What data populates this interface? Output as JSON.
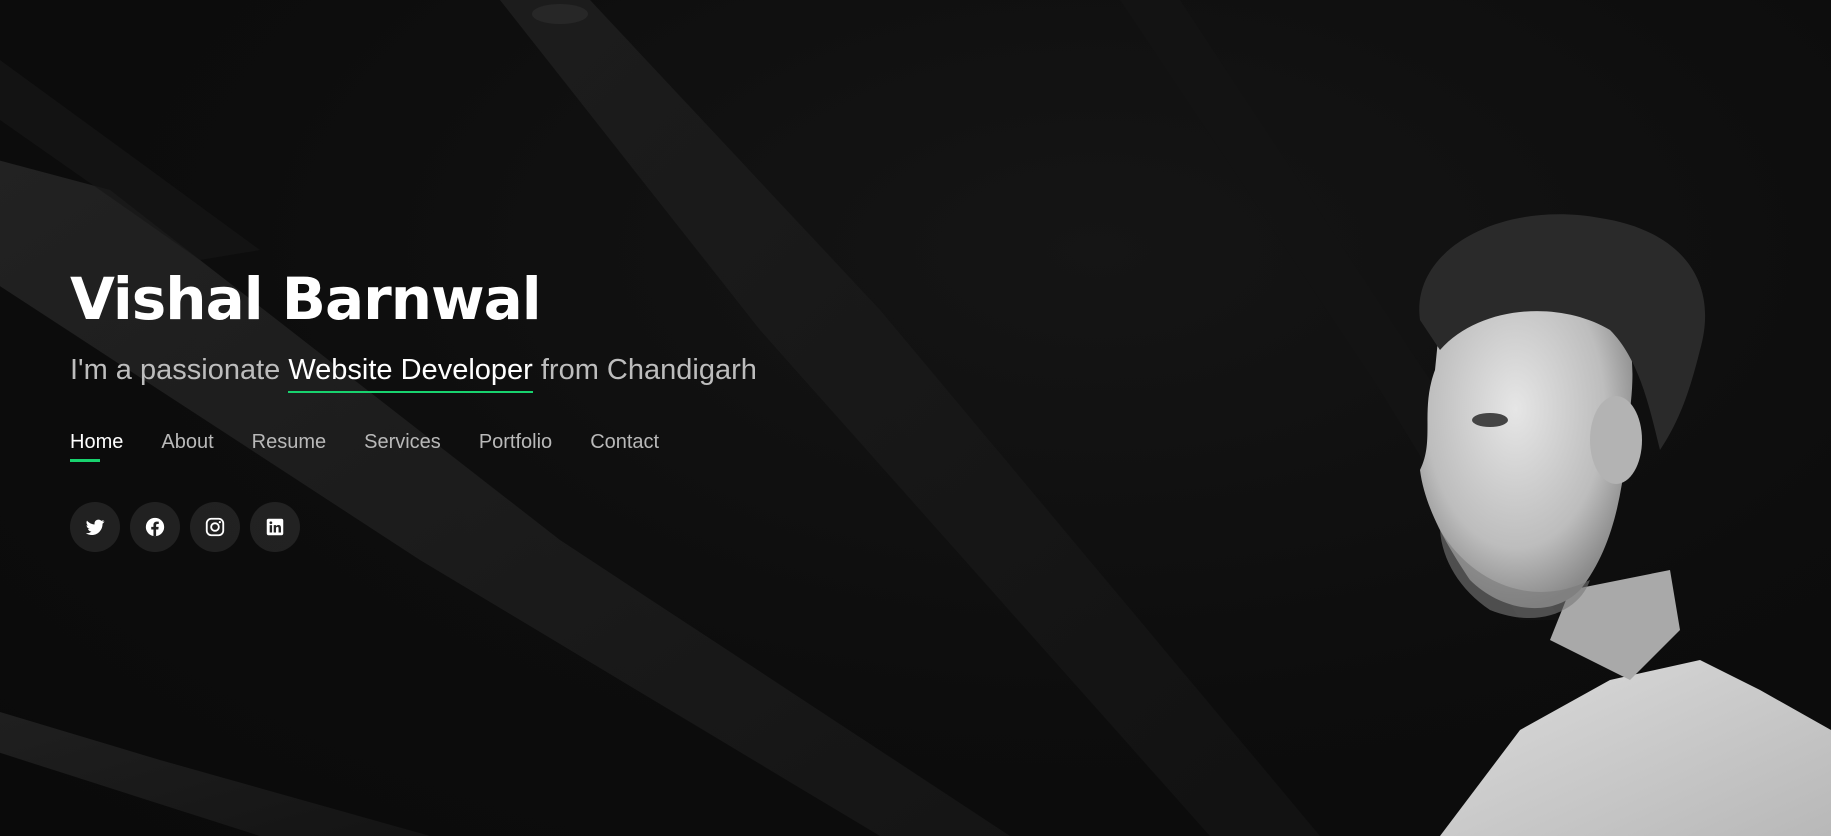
{
  "hero": {
    "name": "Vishal Barnwal",
    "tagline": {
      "prefix": "I'm a passionate ",
      "highlight": "Website Developer",
      "suffix": " from Chandigarh"
    }
  },
  "nav": {
    "items": [
      {
        "label": "Home",
        "active": true
      },
      {
        "label": "About",
        "active": false
      },
      {
        "label": "Resume",
        "active": false
      },
      {
        "label": "Services",
        "active": false
      },
      {
        "label": "Portfolio",
        "active": false
      },
      {
        "label": "Contact",
        "active": false
      }
    ]
  },
  "social": {
    "icons": [
      "twitter-icon",
      "facebook-icon",
      "instagram-icon",
      "linkedin-icon"
    ]
  },
  "colors": {
    "accent": "#18d26e",
    "background": "#0c0c0c",
    "text_primary": "#ffffff",
    "text_secondary": "#bdbdbd"
  }
}
